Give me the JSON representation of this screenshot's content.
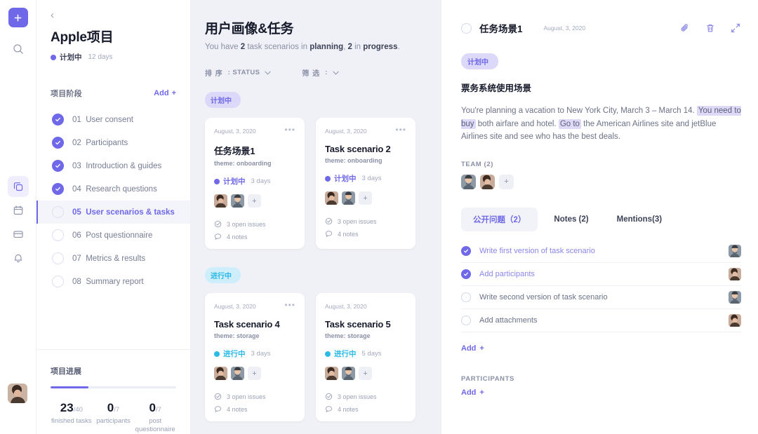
{
  "colors": {
    "accent": "#6f68e8",
    "accent_soft": "#dcd8fa",
    "cyan": "#2bb9e8",
    "cyan_soft": "#cfeefb",
    "board_bg": "#f0f1f6",
    "text_dark": "#171a2b",
    "text_muted": "#8a90a6"
  },
  "rail": {
    "add_label": "+",
    "items": [
      {
        "icon": "plus-icon",
        "active": true
      },
      {
        "icon": "search-icon",
        "active": false
      },
      {
        "icon": "projects-icon",
        "active": true
      },
      {
        "icon": "calendar-icon",
        "active": false
      },
      {
        "icon": "card-icon",
        "active": false
      },
      {
        "icon": "bell-icon",
        "active": false
      }
    ],
    "avatar": "user-avatar"
  },
  "sidebar": {
    "back_label": "‹",
    "project_title": "Apple项目",
    "status_label": "计划中",
    "duration": "12 days",
    "section_title": "项目阶段",
    "add_label": "Add",
    "add_plus": "+",
    "phases": [
      {
        "num": "01",
        "label": "User consent",
        "done": true,
        "active": false
      },
      {
        "num": "02",
        "label": "Participants",
        "done": true,
        "active": false
      },
      {
        "num": "03",
        "label": "Introduction & guides",
        "done": true,
        "active": false
      },
      {
        "num": "04",
        "label": "Research questions",
        "done": true,
        "active": false
      },
      {
        "num": "05",
        "label": "User scenarios & tasks",
        "done": false,
        "active": true
      },
      {
        "num": "06",
        "label": "Post questionnaire",
        "done": false,
        "active": false
      },
      {
        "num": "07",
        "label": "Metrics & results",
        "done": false,
        "active": false
      },
      {
        "num": "08",
        "label": "Summary report",
        "done": false,
        "active": false
      }
    ],
    "progress": {
      "title": "项目进展",
      "percent": 30,
      "stats": [
        {
          "value": "23",
          "denom": "/40",
          "label": "finished tasks"
        },
        {
          "value": "0",
          "denom": "/7",
          "label": "participants"
        },
        {
          "value": "0",
          "denom": "/7",
          "label": "post questionnaire"
        }
      ]
    }
  },
  "board": {
    "title": "用户画像&任务",
    "subtitle_pre": "You have ",
    "subtitle_n1": "2",
    "subtitle_mid": " task scenarios in ",
    "subtitle_b1": "planning",
    "subtitle_mid2": ", ",
    "subtitle_n2": "2",
    "subtitle_mid3": " in ",
    "subtitle_b2": "progress",
    "subtitle_end": ".",
    "sort": {
      "key": "排 序",
      "value": ": STATUS",
      "caret": "⌄"
    },
    "filter": {
      "key": "筛 选",
      "value": ":",
      "caret": "⌄"
    },
    "groups": [
      {
        "pill": "计划中",
        "pill_type": "plan",
        "cards": [
          {
            "date": "August, 3, 2020",
            "more": "•••",
            "title": "任务场景1",
            "theme": "theme: onboarding",
            "status": "计划中",
            "status_type": "plan",
            "days": "3 days",
            "avatars": 2,
            "add": "+",
            "issues": "3 open issues",
            "notes": "4 notes"
          },
          {
            "date": "August, 3, 2020",
            "more": "•••",
            "title": "Task scenario 2",
            "theme": "theme: onboarding",
            "status": "计划中",
            "status_type": "plan",
            "days": "3 days",
            "avatars": 2,
            "add": "+",
            "issues": "3 open issues",
            "notes": "4 notes"
          }
        ]
      },
      {
        "pill": "进行中",
        "pill_type": "prog",
        "cards": [
          {
            "date": "August, 3, 2020",
            "more": "•••",
            "title": "Task scenario 4",
            "theme": "theme: storage",
            "status": "进行中",
            "status_type": "prog",
            "days": "3 days",
            "avatars": 2,
            "add": "+",
            "issues": "3 open issues",
            "notes": "4 notes"
          },
          {
            "date": "August, 3, 2020",
            "more": "•••",
            "title": "Task scenario 5",
            "theme": "theme: storage",
            "status": "进行中",
            "status_type": "prog",
            "days": "5 days",
            "avatars": 2,
            "add": "+",
            "issues": "3 open issues",
            "notes": "4 notes"
          }
        ]
      }
    ]
  },
  "detail": {
    "title": "任务场景1",
    "date": "August, 3, 2020",
    "actions": [
      {
        "icon": "paperclip-icon"
      },
      {
        "icon": "trash-icon"
      },
      {
        "icon": "expand-icon"
      }
    ],
    "badge": "计划中",
    "subtitle": "票务系统使用场景",
    "body": {
      "p1": "You're planning a vacation to New York City, March 3 – March 14. ",
      "hl1": "You need to buy",
      "p2": " both airfare and hotel. ",
      "hl2": "Go to",
      "p3": " the American Airlines site and jetBlue Airlines site and see who has the best deals."
    },
    "team_label": "TEAM (2)",
    "team_add": "+",
    "tabs": [
      {
        "label": "公开问题（2）",
        "active": true
      },
      {
        "label": "Notes (2)",
        "active": false
      },
      {
        "label": "Mentions(3)",
        "active": false
      }
    ],
    "todos": [
      {
        "label": "Write first version of task scenario",
        "done": true
      },
      {
        "label": "Add participants",
        "done": true
      },
      {
        "label": "Write second version of task scenario",
        "done": false
      },
      {
        "label": "Add attachments",
        "done": false
      }
    ],
    "add_label": "Add",
    "add_plus": "+",
    "participants_label": "PARTICIPANTS",
    "participants_add_label": "Add",
    "participants_add_plus": "+"
  }
}
